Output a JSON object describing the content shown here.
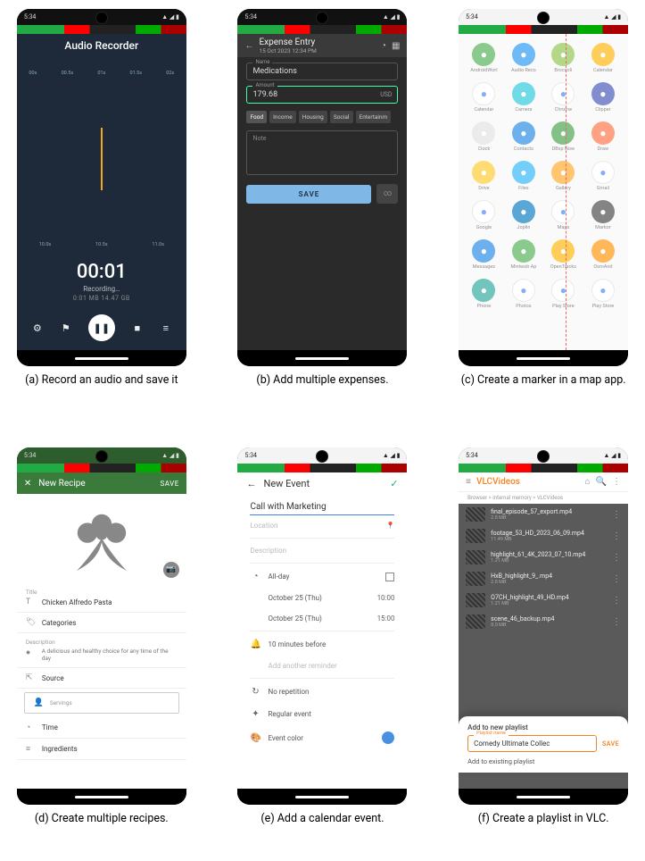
{
  "a": {
    "status_time": "5:34",
    "title": "Audio Recorder",
    "ruler": [
      "00s",
      "00.5s",
      "01s",
      "01.5s",
      "02s"
    ],
    "ruler2": [
      "10.0s",
      "10.5s",
      "11.0s"
    ],
    "timer": "00:01",
    "status": "Recording…",
    "elapsed": "0:01 MB  14.47 GB",
    "caption": "(a) Record an audio and save it"
  },
  "b": {
    "status_time": "5:34",
    "header_title": "Expense Entry",
    "header_sub": "15 Oct 2023 12:34 PM",
    "name_label": "Name",
    "name_value": "Medications",
    "amount_label": "Amount",
    "amount_value": "179.68",
    "currency": "USD",
    "categories": [
      "Food",
      "Income",
      "Housing",
      "Social",
      "Entertainm"
    ],
    "note_label": "Note",
    "save": "SAVE",
    "caption": "(b) Add multiple expenses."
  },
  "c": {
    "apps": [
      {
        "n": "AndroidWorl",
        "c": "#4caf50"
      },
      {
        "n": "Audio Reco",
        "c": "#2196f3"
      },
      {
        "n": "Broccoli",
        "c": "#8bc34a"
      },
      {
        "n": "Calendar",
        "c": "#ffb300"
      },
      {
        "n": "Calendar",
        "c": "#ffffff"
      },
      {
        "n": "Camera",
        "c": "#26c6da"
      },
      {
        "n": "Chrome",
        "c": "#ffffff"
      },
      {
        "n": "Clipper",
        "c": "#3f51b5"
      },
      {
        "n": "Clock",
        "c": "#e0e0e0"
      },
      {
        "n": "Contacts",
        "c": "#1e88e5"
      },
      {
        "n": "DBxp Now",
        "c": "#43a047"
      },
      {
        "n": "Draw",
        "c": "#ff7043"
      },
      {
        "n": "Drive",
        "c": "#ffca28"
      },
      {
        "n": "Files",
        "c": "#29b6f6"
      },
      {
        "n": "Gallery",
        "c": "#ffa726"
      },
      {
        "n": "Gmail",
        "c": "#ffffff"
      },
      {
        "n": "Google",
        "c": "#ffffff"
      },
      {
        "n": "Joplin",
        "c": "#0277bd"
      },
      {
        "n": "Maps",
        "c": "#ffffff"
      },
      {
        "n": "Markor",
        "c": "#424242"
      },
      {
        "n": "Messages",
        "c": "#1e88e5"
      },
      {
        "n": "Miniwob Ap",
        "c": "#4caf50"
      },
      {
        "n": "OpenTracks",
        "c": "#ffb300"
      },
      {
        "n": "OsmAnd",
        "c": "#ff9100"
      },
      {
        "n": "Phone",
        "c": "#26a69a"
      },
      {
        "n": "Photos",
        "c": "#ffffff"
      },
      {
        "n": "Play Store",
        "c": "#ffffff"
      },
      {
        "n": "Play Store",
        "c": "#ffffff"
      }
    ],
    "caption": "(c) Create a marker in a map app."
  },
  "d": {
    "bar_title": "New Recipe",
    "bar_save": "SAVE",
    "title_label": "Title",
    "title_value": "Chicken Alfredo Pasta",
    "cat_label": "Categories",
    "desc_label": "Description",
    "desc_value": "A delicious and healthy choice for any time of the day",
    "source_label": "Source",
    "servings_label": "Servings",
    "time_label": "Time",
    "ingredients_label": "Ingredients",
    "caption": "(d) Create multiple recipes."
  },
  "e": {
    "bar_title": "New Event",
    "event_title": "Call with Marketing",
    "location_ph": "Location",
    "description_ph": "Description",
    "allday": "All-day",
    "date1": "October 25 (Thu)",
    "time1": "10:00",
    "date2": "October 25 (Thu)",
    "time2": "15:00",
    "reminder": "10 minutes before",
    "add_reminder": "Add another reminder",
    "repeat": "No repetition",
    "type": "Regular event",
    "color": "Event color",
    "caption": "(e) Add a calendar event."
  },
  "f": {
    "title": "VLCVideos",
    "crumb": "Browser > internal memory > VLCVideos",
    "files": [
      {
        "n": "final_episode_57_export.mp4",
        "s": "2.8 MB"
      },
      {
        "n": "footage_53_HD_2023_06_09.mp4",
        "s": "11.49 MB"
      },
      {
        "n": "highlight_61_4K_2023_07_10.mp4",
        "s": "1.21 MB"
      },
      {
        "n": "HxB_highlight_9_.mp4",
        "s": "2.8 MB"
      },
      {
        "n": "O7CH_highlight_49_HD.mp4",
        "s": "1.21 MB"
      },
      {
        "n": "scene_46_backup.mp4",
        "s": "8.0 MB"
      }
    ],
    "sheet_new": "Add to new playlist",
    "inp_label": "Playlist name",
    "inp_value": "Comedy Ultimate Collec",
    "save": "SAVE",
    "sheet_existing": "Add to existing playlist",
    "caption": "(f) Create a playlist in VLC."
  }
}
